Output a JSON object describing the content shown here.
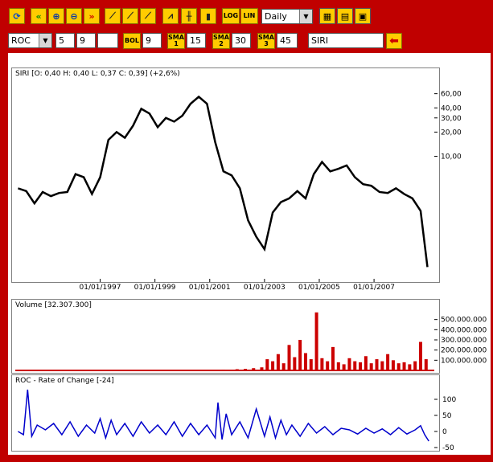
{
  "toolbar_row1": {
    "buttons": [
      {
        "name": "refresh-icon",
        "glyph": "⟳"
      },
      {
        "name": "scroll-left-icon",
        "glyph": "«"
      },
      {
        "name": "zoom-in-icon",
        "glyph": "⊕"
      },
      {
        "name": "zoom-out-icon",
        "glyph": "⊖"
      },
      {
        "name": "scroll-right-icon",
        "glyph": "»"
      },
      {
        "name": "trendline-icon",
        "glyph": "⟋"
      },
      {
        "name": "fan-lines-icon",
        "glyph": "⟋"
      },
      {
        "name": "line-draw-icon",
        "glyph": "⟋"
      },
      {
        "name": "line-chart-icon",
        "glyph": "⩘"
      },
      {
        "name": "bar-chart-icon",
        "glyph": "╫"
      },
      {
        "name": "candlestick-icon",
        "glyph": "▮"
      }
    ],
    "log_label": "LOG",
    "lin_label": "LIN",
    "period": "Daily",
    "grid_buttons": [
      {
        "name": "table-icon",
        "glyph": "▦"
      },
      {
        "name": "list-icon",
        "glyph": "▤"
      },
      {
        "name": "layout-icon",
        "glyph": "▣"
      }
    ]
  },
  "toolbar_row2": {
    "indicator": "ROC",
    "param1": "5",
    "param2": "9",
    "param3": "",
    "bol_label": "BOL",
    "bol_value": "9",
    "sma1_label": "SMA",
    "sma1_num": "1",
    "sma1_value": "15",
    "sma2_label": "SMA",
    "sma2_num": "2",
    "sma2_value": "30",
    "sma3_label": "SMA",
    "sma3_num": "3",
    "sma3_value": "45",
    "symbol": "SIRI",
    "go_glyph": "⬅"
  },
  "colors": {
    "price": "#000000",
    "volume": "#cc0000",
    "roc": "#0000cc",
    "frame": "#c00000",
    "button": "#ffcc00"
  },
  "chart_data": [
    {
      "type": "line",
      "title": "SIRI [O: 0,40  H: 0,40  L: 0,37  C: 0,39] (+2,6%)",
      "scale": "log",
      "ylim": [
        0.3,
        90
      ],
      "y_ticks": [
        60,
        40,
        30,
        20,
        10
      ],
      "y_tick_labels": [
        "60,00",
        "40,00",
        "30,00",
        "20,00",
        "10,00"
      ],
      "x_ticks": [
        "01/01/1997",
        "01/01/1999",
        "01/01/2001",
        "01/01/2003",
        "01/01/2005",
        "01/01/2007"
      ],
      "xlim": [
        1993.9,
        2009.2
      ],
      "x": [
        1994.0,
        1994.3,
        1994.6,
        1994.9,
        1995.2,
        1995.5,
        1995.8,
        1996.1,
        1996.4,
        1996.7,
        1997.0,
        1997.3,
        1997.6,
        1997.9,
        1998.2,
        1998.5,
        1998.8,
        1999.1,
        1999.4,
        1999.7,
        2000.0,
        2000.3,
        2000.6,
        2000.9,
        2001.2,
        2001.5,
        2001.8,
        2002.1,
        2002.4,
        2002.7,
        2003.0,
        2003.3,
        2003.6,
        2003.9,
        2004.2,
        2004.5,
        2004.8,
        2005.1,
        2005.4,
        2005.7,
        2006.0,
        2006.3,
        2006.6,
        2006.9,
        2007.2,
        2007.5,
        2007.8,
        2008.1,
        2008.4,
        2008.7,
        2008.95
      ],
      "y": [
        4.0,
        3.7,
        2.6,
        3.6,
        3.2,
        3.5,
        3.6,
        6.0,
        5.5,
        3.4,
        5.5,
        16,
        20,
        17,
        24,
        39,
        34,
        23,
        30,
        27,
        32,
        45,
        55,
        45,
        15,
        6.5,
        5.8,
        4.0,
        1.6,
        1.0,
        0.7,
        2.0,
        2.7,
        3.0,
        3.7,
        3.0,
        6.0,
        8.5,
        6.5,
        7.0,
        7.7,
        5.5,
        4.5,
        4.3,
        3.6,
        3.5,
        4.0,
        3.4,
        3.0,
        2.1,
        0.42
      ],
      "xlabel": "",
      "ylabel": ""
    },
    {
      "type": "bar",
      "title": "Volume [32.307.300]",
      "ylim": [
        0,
        600000000
      ],
      "y_ticks": [
        500000000,
        400000000,
        300000000,
        200000000,
        100000000
      ],
      "y_tick_labels": [
        "500.000.000",
        "400.000.000",
        "300.000.000",
        "200.000.000",
        "100.000.000"
      ],
      "xlim": [
        1993.9,
        2009.2
      ],
      "x": [
        2001.0,
        2001.5,
        2002.0,
        2002.3,
        2002.6,
        2002.9,
        2003.1,
        2003.3,
        2003.5,
        2003.7,
        2003.9,
        2004.1,
        2004.3,
        2004.5,
        2004.7,
        2004.9,
        2005.1,
        2005.3,
        2005.5,
        2005.7,
        2005.9,
        2006.1,
        2006.3,
        2006.5,
        2006.7,
        2006.9,
        2007.1,
        2007.3,
        2007.5,
        2007.7,
        2007.9,
        2008.1,
        2008.3,
        2008.5,
        2008.7,
        2008.9
      ],
      "values": [
        6000000,
        8000000,
        12000000,
        15000000,
        22000000,
        30000000,
        110000000,
        90000000,
        160000000,
        70000000,
        250000000,
        130000000,
        300000000,
        170000000,
        110000000,
        570000000,
        120000000,
        90000000,
        230000000,
        80000000,
        60000000,
        120000000,
        90000000,
        80000000,
        140000000,
        70000000,
        110000000,
        90000000,
        160000000,
        100000000,
        70000000,
        80000000,
        60000000,
        90000000,
        280000000,
        110000000
      ],
      "xlabel": "",
      "ylabel": ""
    },
    {
      "type": "line",
      "title": "ROC - Rate of Change [-24]",
      "ylim": [
        -55,
        140
      ],
      "y_ticks": [
        100,
        50,
        0,
        -50
      ],
      "y_tick_labels": [
        "100",
        "50",
        "0",
        "-50"
      ],
      "xlim": [
        1993.9,
        2009.2
      ],
      "x": [
        1994.0,
        1994.2,
        1994.35,
        1994.5,
        1994.7,
        1995.0,
        1995.3,
        1995.6,
        1995.9,
        1996.2,
        1996.5,
        1996.8,
        1997.0,
        1997.2,
        1997.4,
        1997.6,
        1997.9,
        1998.2,
        1998.5,
        1998.8,
        1999.1,
        1999.4,
        1999.7,
        2000.0,
        2000.3,
        2000.6,
        2000.9,
        2001.2,
        2001.3,
        2001.45,
        2001.6,
        2001.8,
        2002.1,
        2002.4,
        2002.7,
        2003.0,
        2003.2,
        2003.4,
        2003.6,
        2003.8,
        2004.0,
        2004.3,
        2004.6,
        2004.9,
        2005.2,
        2005.5,
        2005.8,
        2006.1,
        2006.4,
        2006.7,
        2007.0,
        2007.3,
        2007.6,
        2007.9,
        2008.2,
        2008.5,
        2008.7,
        2008.85,
        2009.0
      ],
      "y": [
        0,
        -10,
        130,
        -15,
        20,
        5,
        25,
        -10,
        30,
        -15,
        20,
        -5,
        40,
        -20,
        35,
        -10,
        25,
        -15,
        30,
        -5,
        20,
        -10,
        30,
        -15,
        25,
        -10,
        20,
        -20,
        90,
        -25,
        55,
        -10,
        30,
        -20,
        70,
        -15,
        45,
        -20,
        35,
        -10,
        20,
        -15,
        25,
        -5,
        15,
        -10,
        10,
        5,
        -8,
        10,
        -5,
        8,
        -10,
        12,
        -8,
        5,
        18,
        -10,
        -30
      ],
      "xlabel": "",
      "ylabel": ""
    }
  ]
}
